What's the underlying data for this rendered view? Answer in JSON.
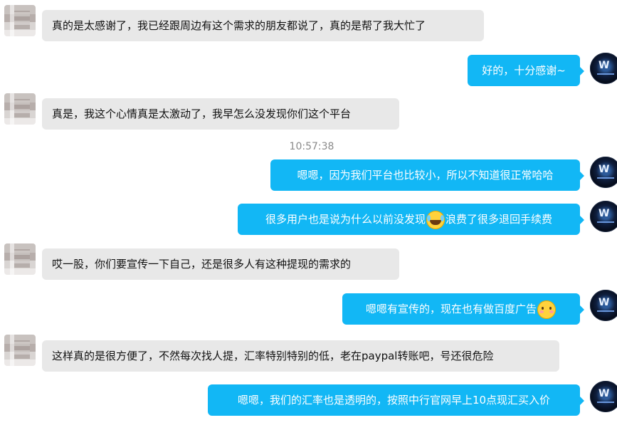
{
  "messages": [
    {
      "side": "left",
      "text": "真的是太感谢了，我已经跟周边有这个需求的朋友都说了，真的是帮了我大忙了"
    },
    {
      "side": "right",
      "text": "好的，十分感谢~"
    },
    {
      "side": "left",
      "text": "真是，我这个心情真是太激动了，我早怎么没发现你们这个平台"
    },
    {
      "side": "right",
      "text": "嗯嗯，因为我们平台也比较小，所以不知道很正常哈哈"
    },
    {
      "side": "right",
      "text_before": "很多用户也是说为什么以前没发现",
      "emoji": "laughing-tears",
      "text_after": "浪费了很多退回手续费"
    },
    {
      "side": "left",
      "text": "哎一股，你们要宣传一下自己，还是很多人有这种提现的需求的"
    },
    {
      "side": "right",
      "text": "嗯嗯有宣传的，现在也有做百度广告",
      "emoji": "blush-smile"
    },
    {
      "side": "left",
      "text": "这样真的是很方便了，不然每次找人提，汇率特别特别的低，老在paypal转账吧，号还很危险"
    },
    {
      "side": "right",
      "text": "嗯嗯，我们的汇率也是透明的，按照中行官网早上10点现汇买入价"
    }
  ],
  "timestamp": "10:57:38",
  "colors": {
    "incoming_bubble": "#e8e8e8",
    "outgoing_bubble": "#12b7f5",
    "timestamp_text": "#8a8a8a"
  }
}
